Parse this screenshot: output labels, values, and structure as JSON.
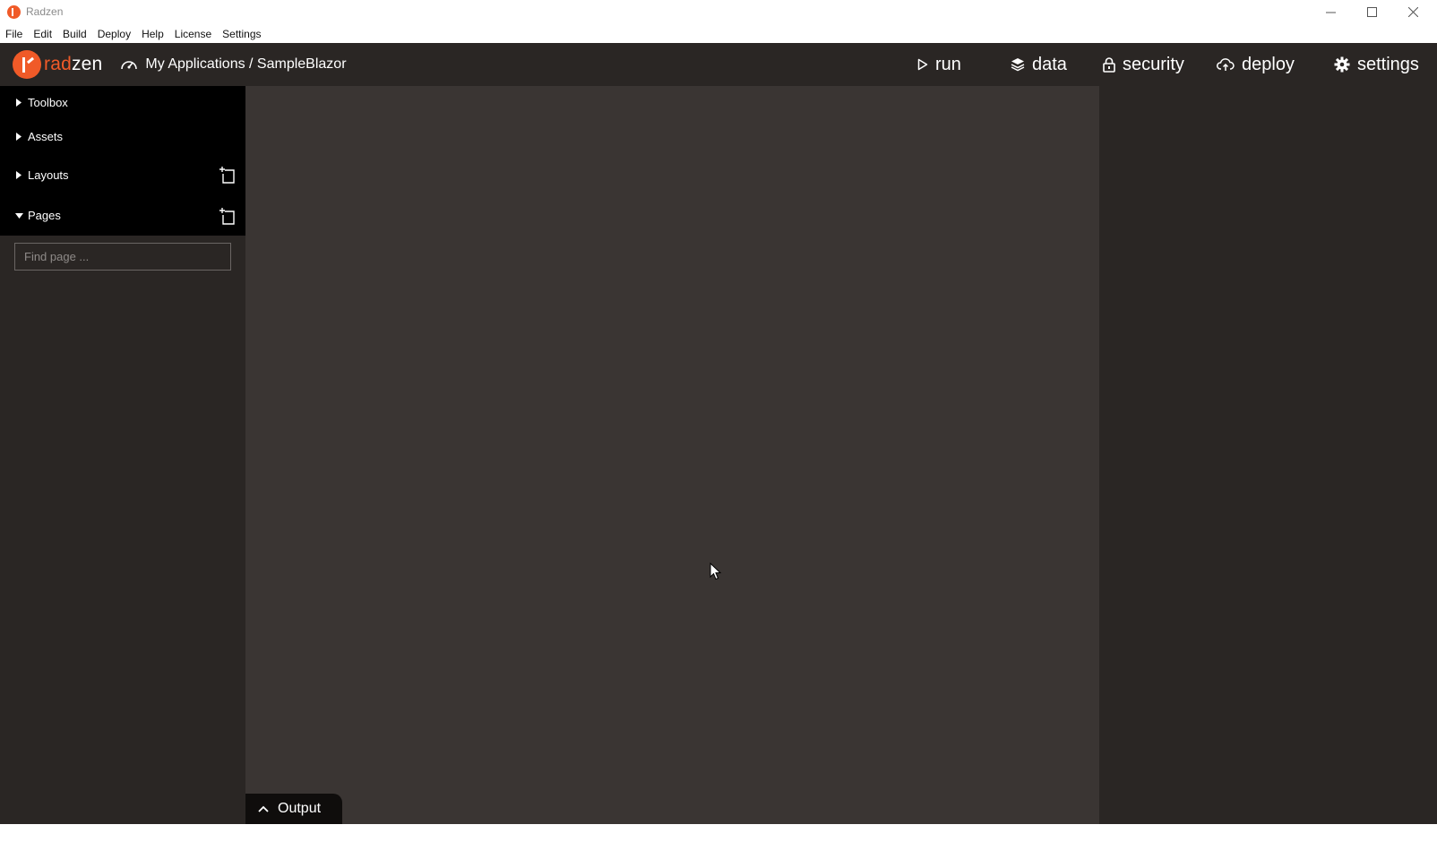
{
  "window": {
    "title": "Radzen"
  },
  "menubar": [
    "File",
    "Edit",
    "Build",
    "Deploy",
    "Help",
    "License",
    "Settings"
  ],
  "header": {
    "logo_rad": "rad",
    "logo_zen": "zen",
    "breadcrumb": "My Applications / SampleBlazor",
    "nav": {
      "run": "run",
      "data": "data",
      "security": "security",
      "deploy": "deploy",
      "settings": "settings"
    }
  },
  "sidebar": {
    "toolbox": "Toolbox",
    "assets": "Assets",
    "layouts": "Layouts",
    "pages": "Pages",
    "find_placeholder": "Find page ..."
  },
  "output": {
    "label": "Output"
  },
  "colors": {
    "accent": "#f05a28",
    "header_bg": "#2a2624",
    "canvas_bg": "#3a3533",
    "panel_header_bg": "#000000"
  }
}
